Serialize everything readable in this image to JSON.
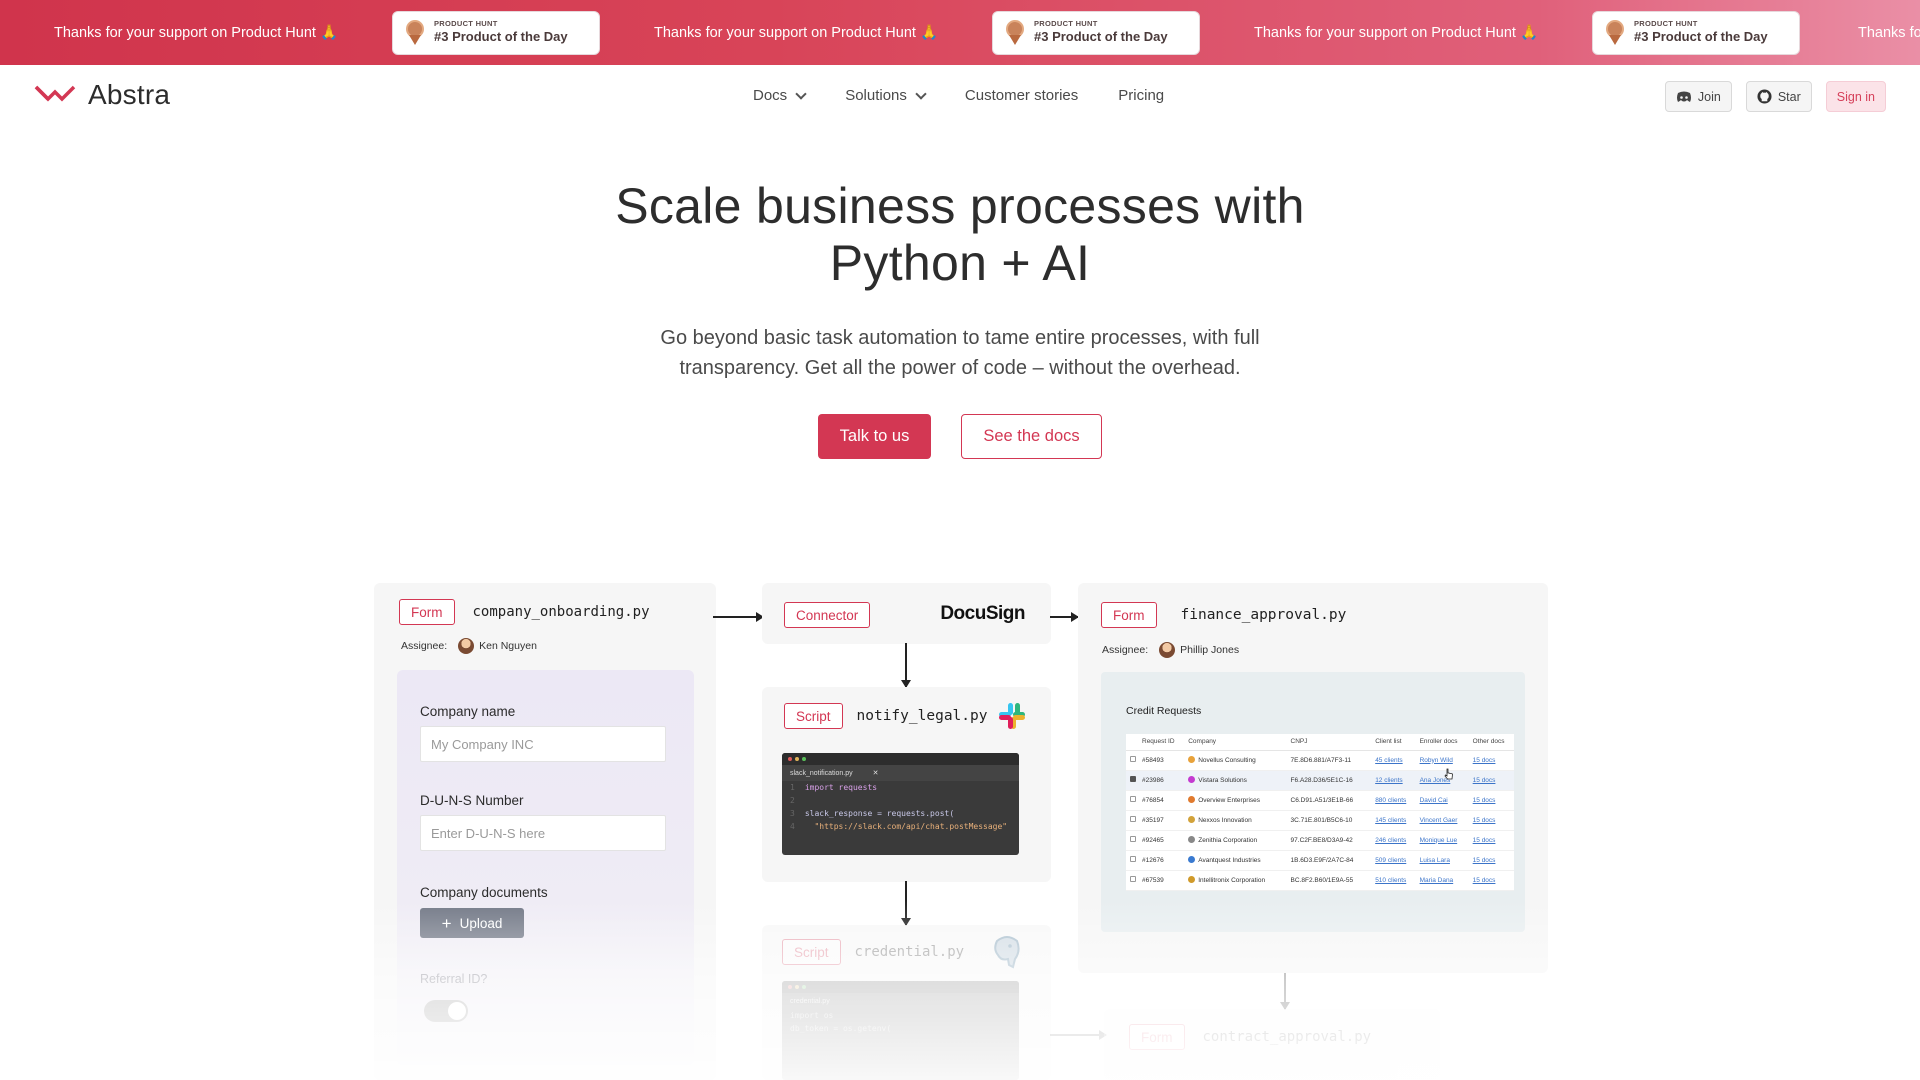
{
  "banner": {
    "support_text": "Thanks for your support on Product Hunt 🙏",
    "badge_small": "PRODUCT HUNT",
    "badge_big": "#3 Product of the Day",
    "trailing_text": "Thanks for y"
  },
  "nav": {
    "logo_text": "Abstra",
    "links": [
      "Docs",
      "Solutions",
      "Customer stories",
      "Pricing"
    ],
    "join_label": "Join",
    "star_label": "Star",
    "sign_in_label": "Sign in"
  },
  "hero": {
    "title_line1": "Scale business processes with",
    "title_line2": "Python + AI",
    "subtitle_line1": "Go beyond basic task automation to tame entire processes, with full",
    "subtitle_line2": "transparency. Get all the power of code – without the overhead.",
    "primary_cta": "Talk to us",
    "secondary_cta": "See the docs"
  },
  "workflow": {
    "onboarding": {
      "tag": "Form",
      "file": "company_onboarding.py",
      "assignee_label": "Assignee:",
      "assignee_name": "Ken Nguyen",
      "field1_label": "Company name",
      "field1_placeholder": "My Company INC",
      "field2_label": "D-U-N-S Number",
      "field2_placeholder": "Enter D-U-N-S here",
      "field3_label": "Company documents",
      "upload_label": "Upload",
      "field4_label": "Referral ID?"
    },
    "connector": {
      "tag": "Connector",
      "brand": "DocuSign"
    },
    "notify": {
      "tag": "Script",
      "file": "notify_legal.py",
      "tab_name": "slack_notification.py",
      "code": [
        "import requests",
        "",
        "slack_response = requests.post(",
        "  \"https://slack.com/api/chat.postMessage\""
      ],
      "line_numbers": [
        "1",
        "2",
        "3",
        "4"
      ]
    },
    "credential": {
      "tag": "Script",
      "file": "credential.py",
      "tab_name": "credential.py",
      "code": [
        "import os",
        "",
        "db_token = os.getenv("
      ]
    },
    "finance": {
      "tag": "Form",
      "file": "finance_approval.py",
      "assignee_label": "Assignee:",
      "assignee_name": "Phillip Jones",
      "table_title": "Credit Requests",
      "columns": [
        "Request ID",
        "Company",
        "CNPJ",
        "Client list",
        "Enroller docs",
        "Other docs"
      ],
      "rows": [
        [
          "#58493",
          "Novellus Consulting",
          "7E.8D6.881/A7F3-11",
          "45 clients",
          "Robyn Wild",
          "15 docs"
        ],
        [
          "#23986",
          "Vistara Solutions",
          "F6.A28.D36/5E1C-16",
          "12 clients",
          "Ana Jones",
          "15 docs"
        ],
        [
          "#76854",
          "Overview Enterprises",
          "C6.D91.A51/3E1B-66",
          "880 clients",
          "David Cai",
          "15 docs"
        ],
        [
          "#35197",
          "Nexxos Innovation",
          "3C.71E.801/B5C6-10",
          "145 clients",
          "Vincent Gaer",
          "15 docs"
        ],
        [
          "#92465",
          "Zenithia Corporation",
          "97.C2F.BE8/D3A9-42",
          "246 clients",
          "Monique Lue",
          "15 docs"
        ],
        [
          "#12676",
          "Avantquest Industries",
          "1B.6D3.E9F/2A7C-84",
          "509 clients",
          "Luisa Lara",
          "15 docs"
        ],
        [
          "#67539",
          "Intellitronix Corporation",
          "BC.8F2.B60/1E9A-55",
          "510 clients",
          "Maria Dana",
          "15 docs"
        ]
      ],
      "checked_row": 1,
      "company_logo_colors": [
        "#e8a23a",
        "#c43ad0",
        "#e07a2e",
        "#d2a23a",
        "#888888",
        "#3a7ad0",
        "#d09a2a"
      ]
    },
    "contract": {
      "tag": "Form",
      "file": "contract_approval.py"
    }
  },
  "colors": {
    "accent": "#d33753",
    "banner_start": "#d0344c",
    "banner_end": "#ea8fa6"
  },
  "icons": {
    "logo": "abstra-logo-icon",
    "medal": "medal-icon",
    "discord": "discord-icon",
    "github": "github-icon",
    "slack": "slack-icon",
    "postgres": "postgres-icon",
    "plus": "plus-icon"
  }
}
